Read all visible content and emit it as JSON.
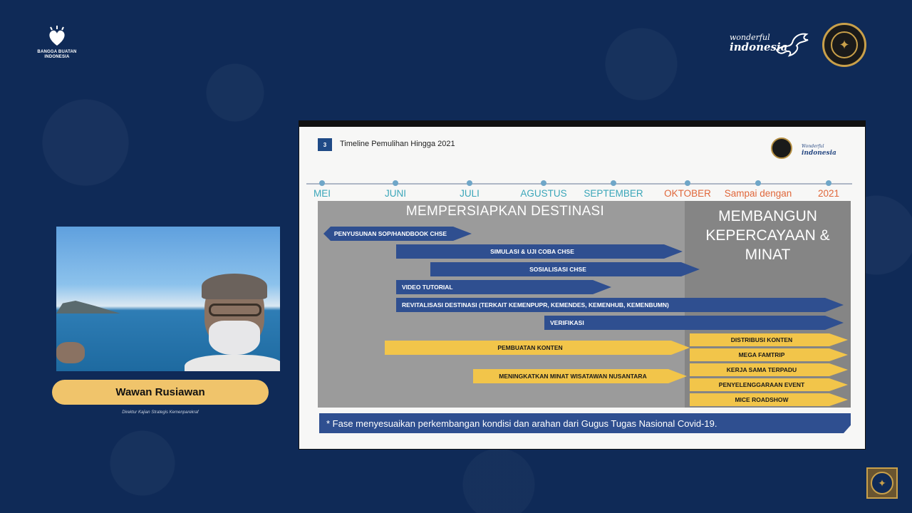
{
  "brand": {
    "left_logo_text": "BANGGA BUATAN INDONESIA",
    "wonderful_line1": "wonderful",
    "wonderful_line2": "indonesia"
  },
  "participant": {
    "name": "Wawan Rusiawan",
    "caption": "Direktur Kajian Strategis Kemenparekraf"
  },
  "slide": {
    "number": "3",
    "title": "Timeline Pemulihan Hingga 2021",
    "small_logo_text": "indonesia",
    "small_logo_prefix": "Wonderful",
    "timeline": [
      {
        "label": "MEI",
        "color": "#3aa6b9"
      },
      {
        "label": "JUNI",
        "color": "#3aa6b9"
      },
      {
        "label": "JULI",
        "color": "#3aa6b9"
      },
      {
        "label": "AGUSTUS",
        "color": "#3aa6b9"
      },
      {
        "label": "SEPTEMBER",
        "color": "#3aa6b9"
      },
      {
        "label": "OKTOBER",
        "color": "#e0673a"
      },
      {
        "label": "Sampai dengan",
        "color": "#e0673a"
      },
      {
        "label": "2021",
        "color": "#e0673a"
      }
    ],
    "phase_left_title": "MEMPERSIAPKAN DESTINASI",
    "phase_right_title": "MEMBANGUN KEPERCAYAAN & MINAT",
    "activities": [
      {
        "label": "PENYUSUNAN SOP/HANDBOOK CHSE",
        "color": "blue"
      },
      {
        "label": "SIMULASI & UJI COBA CHSE",
        "color": "blue"
      },
      {
        "label": "SOSIALISASI CHSE",
        "color": "blue"
      },
      {
        "label": "VIDEO TUTORIAL",
        "color": "blue"
      },
      {
        "label": "REVITALISASI  DESTINASI (TERKAIT KEMENPUPR, KEMENDES, KEMENHUB, KEMENBUMN)",
        "color": "blue"
      },
      {
        "label": "VERIFIKASI",
        "color": "blue"
      },
      {
        "label": "PEMBUATAN  KONTEN",
        "color": "yellow"
      },
      {
        "label": "MENINGKATKAN MINAT WISATAWAN NUSANTARA",
        "color": "yellow"
      },
      {
        "label": "DISTRIBUSI  KONTEN",
        "color": "yellow"
      },
      {
        "label": "MEGA  FAMTRIP",
        "color": "yellow"
      },
      {
        "label": "KERJA SAMA  TERPADU",
        "color": "yellow"
      },
      {
        "label": "PENYELENGGARAAN  EVENT",
        "color": "yellow"
      },
      {
        "label": "MICE  ROADSHOW",
        "color": "yellow"
      }
    ],
    "footnote": "* Fase menyesuaikan perkembangan kondisi dan arahan dari Gugus Tugas Nasional Covid-19."
  },
  "icons": {
    "seal": "ministry-seal-icon",
    "bird": "garuda-bird-icon"
  }
}
